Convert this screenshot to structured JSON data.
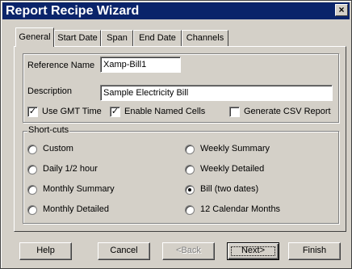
{
  "window": {
    "title": "Report Recipe Wizard",
    "close_glyph": "×"
  },
  "tabs": [
    {
      "label": "General",
      "active": true
    },
    {
      "label": "Start Date",
      "active": false
    },
    {
      "label": "Span",
      "active": false
    },
    {
      "label": "End Date",
      "active": false
    },
    {
      "label": "Channels",
      "active": false
    }
  ],
  "general": {
    "reference_name": {
      "label": "Reference Name",
      "value": "Xamp-Bill1"
    },
    "description": {
      "label": "Description",
      "value": "Sample Electricity Bill"
    },
    "options": [
      {
        "label": "Use GMT Time",
        "checked": true
      },
      {
        "label": "Enable Named Cells",
        "checked": true
      },
      {
        "label": "Generate CSV Report",
        "checked": false
      }
    ]
  },
  "shortcuts": {
    "legend": "Short-cuts",
    "left": [
      {
        "label": "Custom",
        "selected": false
      },
      {
        "label": "Daily 1/2 hour",
        "selected": false
      },
      {
        "label": "Monthly Summary",
        "selected": false
      },
      {
        "label": "Monthly Detailed",
        "selected": false
      }
    ],
    "right": [
      {
        "label": "Weekly Summary",
        "selected": false
      },
      {
        "label": "Weekly Detailed",
        "selected": false
      },
      {
        "label": "Bill (two dates)",
        "selected": true
      },
      {
        "label": "12 Calendar Months",
        "selected": false
      }
    ]
  },
  "buttons": {
    "help": "Help",
    "cancel": "Cancel",
    "back": "<Back",
    "next": "Next>",
    "finish": "Finish"
  },
  "icons": {
    "check_glyph": "✓"
  }
}
